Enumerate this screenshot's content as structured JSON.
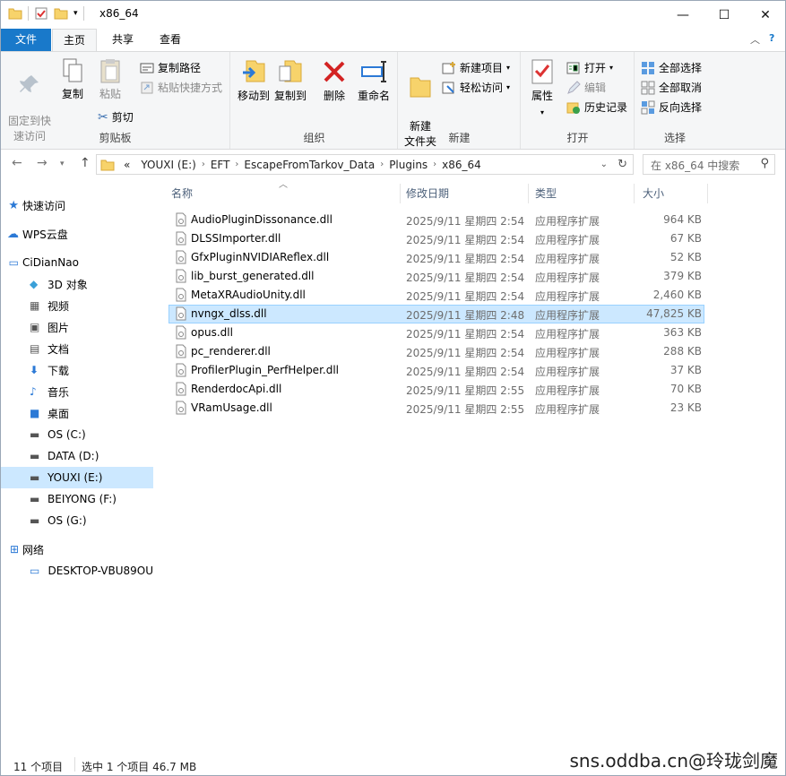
{
  "window": {
    "title": "x86_64"
  },
  "tabs": {
    "file": "文件",
    "home": "主页",
    "share": "共享",
    "view": "查看"
  },
  "ribbon": {
    "clipboard": {
      "pin": "固定到快\n速访问",
      "copy": "复制",
      "paste": "粘贴",
      "copy_path": "复制路径",
      "paste_shortcut": "粘贴快捷方式",
      "cut": "剪切",
      "label": "剪贴板"
    },
    "organize": {
      "move_to": "移动到",
      "copy_to": "复制到",
      "delete": "删除",
      "rename": "重命名",
      "label": "组织"
    },
    "new": {
      "new_folder": "新建\n文件夹",
      "new_item": "新建项目",
      "easy_access": "轻松访问",
      "label": "新建"
    },
    "open": {
      "properties": "属性",
      "open": "打开",
      "edit": "编辑",
      "history": "历史记录",
      "label": "打开"
    },
    "select": {
      "select_all": "全部选择",
      "select_none": "全部取消",
      "invert": "反向选择",
      "label": "选择"
    }
  },
  "address": {
    "crumbs": [
      "«",
      "YOUXI (E:)",
      "EFT",
      "EscapeFromTarkov_Data",
      "Plugins",
      "x86_64"
    ],
    "search_placeholder": "在 x86_64 中搜索"
  },
  "nav": {
    "quick_access": "快速访问",
    "wps": "WPS云盘",
    "pc": "CiDianNao",
    "folders": [
      "3D 对象",
      "视频",
      "图片",
      "文档",
      "下载",
      "音乐",
      "桌面"
    ],
    "drives": [
      "OS (C:)",
      "DATA (D:)",
      "YOUXI (E:)",
      "BEIYONG (F:)",
      "OS (G:)"
    ],
    "network": "网络",
    "desktop_pc": "DESKTOP-VBU89OU"
  },
  "columns": {
    "name": "名称",
    "date": "修改日期",
    "type": "类型",
    "size": "大小"
  },
  "files": [
    {
      "name": "AudioPluginDissonance.dll",
      "date": "2025/9/11 星期四 2:54",
      "type": "应用程序扩展",
      "size": "964 KB"
    },
    {
      "name": "DLSSImporter.dll",
      "date": "2025/9/11 星期四 2:54",
      "type": "应用程序扩展",
      "size": "67 KB"
    },
    {
      "name": "GfxPluginNVIDIAReflex.dll",
      "date": "2025/9/11 星期四 2:54",
      "type": "应用程序扩展",
      "size": "52 KB"
    },
    {
      "name": "lib_burst_generated.dll",
      "date": "2025/9/11 星期四 2:54",
      "type": "应用程序扩展",
      "size": "379 KB"
    },
    {
      "name": "MetaXRAudioUnity.dll",
      "date": "2025/9/11 星期四 2:54",
      "type": "应用程序扩展",
      "size": "2,460 KB"
    },
    {
      "name": "nvngx_dlss.dll",
      "date": "2025/9/11 星期四 2:48",
      "type": "应用程序扩展",
      "size": "47,825 KB"
    },
    {
      "name": "opus.dll",
      "date": "2025/9/11 星期四 2:54",
      "type": "应用程序扩展",
      "size": "363 KB"
    },
    {
      "name": "pc_renderer.dll",
      "date": "2025/9/11 星期四 2:54",
      "type": "应用程序扩展",
      "size": "288 KB"
    },
    {
      "name": "ProfilerPlugin_PerfHelper.dll",
      "date": "2025/9/11 星期四 2:54",
      "type": "应用程序扩展",
      "size": "37 KB"
    },
    {
      "name": "RenderdocApi.dll",
      "date": "2025/9/11 星期四 2:55",
      "type": "应用程序扩展",
      "size": "70 KB"
    },
    {
      "name": "VRamUsage.dll",
      "date": "2025/9/11 星期四 2:55",
      "type": "应用程序扩展",
      "size": "23 KB"
    }
  ],
  "status": {
    "count": "11 个项目",
    "selected": "选中 1 个项目 46.7 MB"
  },
  "watermark": "sns.oddba.cn@玲珑剑魔"
}
